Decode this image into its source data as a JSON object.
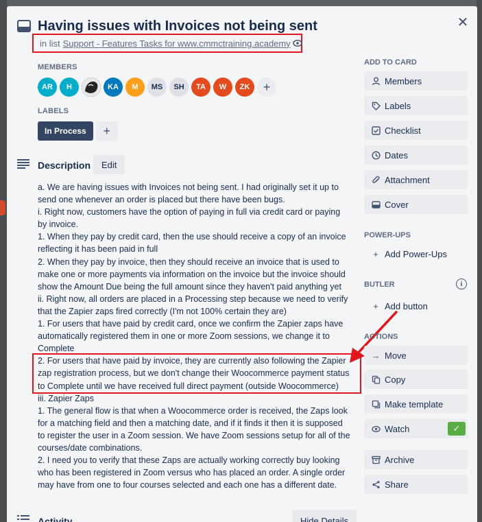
{
  "card": {
    "title": "Having issues with Invoices not being sent",
    "in_list_prefix": "in list",
    "list_name": "Support - Features Tasks for www.cmmctraining.academy"
  },
  "members": {
    "label": "MEMBERS",
    "avatars": [
      {
        "initials": "AR",
        "color": "#00aecc"
      },
      {
        "initials": "H",
        "color": "#00aecc"
      },
      {
        "initials": "",
        "color": "#1f1f1f"
      },
      {
        "initials": "KA",
        "color": "#0079bf"
      },
      {
        "initials": "M",
        "color": "#ff9f1a"
      },
      {
        "initials": "MS",
        "color": "#dfe1e6"
      },
      {
        "initials": "SH",
        "color": "#dfe1e6"
      },
      {
        "initials": "TA",
        "color": "#e34a1c"
      },
      {
        "initials": "W",
        "color": "#e34a1c"
      },
      {
        "initials": "ZK",
        "color": "#e34a1c"
      }
    ],
    "add_symbol": "+"
  },
  "labels": {
    "label": "LABELS",
    "items": [
      "In Process"
    ],
    "add_symbol": "+"
  },
  "description": {
    "title": "Description",
    "edit_label": "Edit",
    "lines": [
      "a. We are having issues with Invoices not being sent. I had originally set it up to",
      "send one whenever an order is placed but there have been bugs.",
      "i. Right now, customers have the option of paying in full via credit card or paying",
      "by invoice.",
      "1. When they pay by credit card, then the use should receive a copy of an invoice",
      "reflecting it has been paid in full",
      "2. When they pay by invoice, then they should receive an invoice that is used to",
      "make one or more payments via information on the invoice but the invoice should",
      "show the Amount Due being the full amount since they haven't paid anything yet",
      "ii. Right now, all orders are placed in a Processing step because we need to verify",
      "that the Zapier zaps fired correctly (I'm not 100% certain they are)",
      "1. For users that have paid by credit card, once we confirm the Zapier zaps have",
      "automatically registered them in one or more Zoom sessions, we change it to",
      "Complete",
      "2. For users that have paid by invoice, they are currently also following the Zapier",
      "zap registration process, but we don't change their Woocommerce payment status",
      "to Complete until we have received full direct payment (outside Woocommerce)",
      "iii. Zapier Zaps",
      "1. The general flow is that when a Woocommerce order is received, the Zaps look",
      "for a matching field and then a matching date, and if it finds it then it is supposed",
      "to register the user in a Zoom session. We have Zoom sessions setup for all of the",
      "courses/date combinations.",
      "2. I need you to verify that these Zaps are actually working correctly buy looking",
      "who has been registered in Zoom versus who has placed an order. A single order",
      "may have from one to four courses selected and each one has a different date."
    ]
  },
  "activity": {
    "title": "Activity",
    "hide_details_label": "Hide Details"
  },
  "sidebar": {
    "add_to_card": {
      "label": "ADD TO CARD",
      "buttons": [
        {
          "label": "Members",
          "icon": "person-icon"
        },
        {
          "label": "Labels",
          "icon": "tag-icon"
        },
        {
          "label": "Checklist",
          "icon": "checklist-icon"
        },
        {
          "label": "Dates",
          "icon": "clock-icon"
        },
        {
          "label": "Attachment",
          "icon": "paperclip-icon"
        },
        {
          "label": "Cover",
          "icon": "cover-icon"
        }
      ]
    },
    "power_ups": {
      "label": "POWER-UPS",
      "add_label": "Add Power-Ups"
    },
    "butler": {
      "label": "BUTLER",
      "add_label": "Add button"
    },
    "actions": {
      "label": "ACTIONS",
      "buttons": [
        {
          "label": "Move",
          "icon": "arrow-right-icon"
        },
        {
          "label": "Copy",
          "icon": "copy-icon"
        },
        {
          "label": "Make template",
          "icon": "template-icon"
        },
        {
          "label": "Watch",
          "icon": "eye-icon"
        },
        {
          "label": "Archive",
          "icon": "archive-icon"
        },
        {
          "label": "Share",
          "icon": "share-icon"
        }
      ]
    }
  },
  "colors": {
    "highlight_red": "#e1161c",
    "label_dark": "#344563",
    "watch_green": "#5aac44"
  }
}
